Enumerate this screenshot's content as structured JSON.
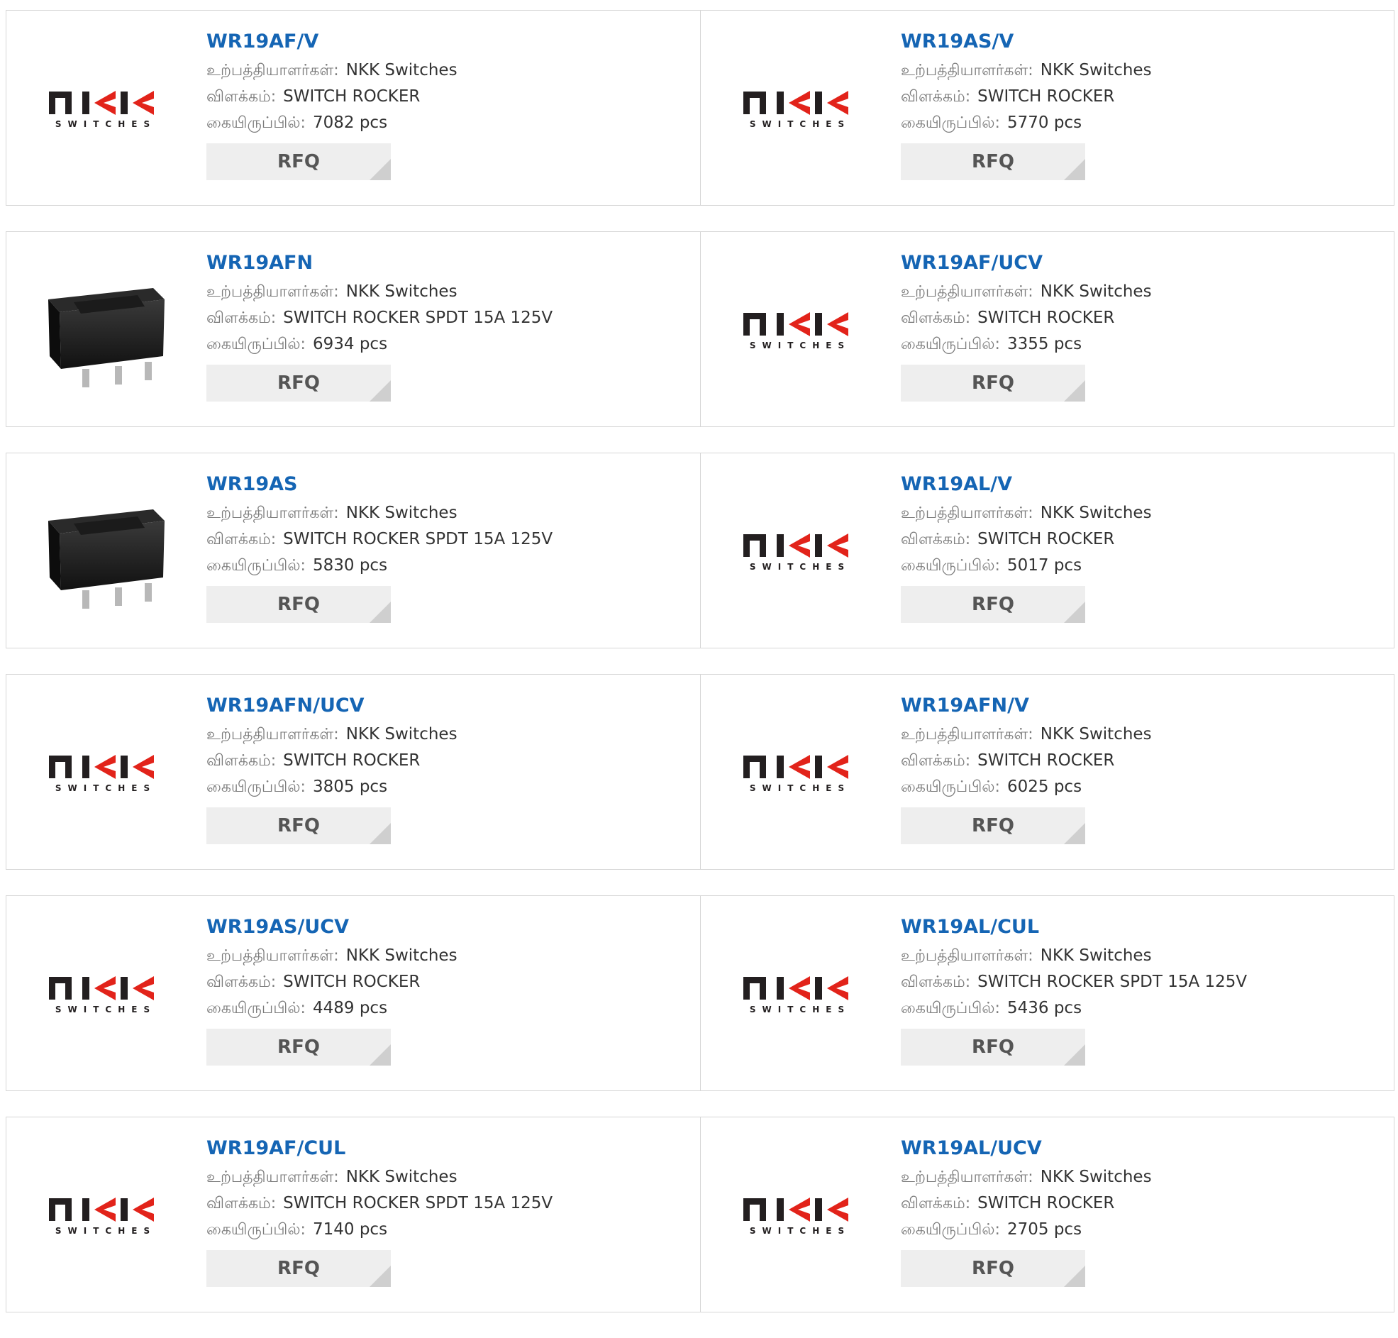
{
  "labels": {
    "manufacturer": "உற்பத்தியாளர்கள்:",
    "description": "விளக்கம்:",
    "stock": "கையிருப்பில்:",
    "rfq": "RFQ"
  },
  "colors": {
    "part_link": "#1565b4",
    "label": "#7c7c7c",
    "value": "#333333",
    "rfq_bg": "#eeeeee",
    "border": "#d6d6d6",
    "logo_red": "#e2231a",
    "logo_black": "#231f20"
  },
  "logo": {
    "wordmark": "NKK",
    "subtext": "SWITCHES"
  },
  "products": [
    {
      "part": "WR19AF/V",
      "manufacturer": "NKK Switches",
      "description": "SWITCH ROCKER",
      "stock": "7082 pcs",
      "image": "nkk-logo"
    },
    {
      "part": "WR19AS/V",
      "manufacturer": "NKK Switches",
      "description": "SWITCH ROCKER",
      "stock": "5770 pcs",
      "image": "nkk-logo"
    },
    {
      "part": "WR19AFN",
      "manufacturer": "NKK Switches",
      "description": "SWITCH ROCKER SPDT 15A 125V",
      "stock": "6934 pcs",
      "image": "rocker-switch-photo"
    },
    {
      "part": "WR19AF/UCV",
      "manufacturer": "NKK Switches",
      "description": "SWITCH ROCKER",
      "stock": "3355 pcs",
      "image": "nkk-logo"
    },
    {
      "part": "WR19AS",
      "manufacturer": "NKK Switches",
      "description": "SWITCH ROCKER SPDT 15A 125V",
      "stock": "5830 pcs",
      "image": "rocker-switch-photo"
    },
    {
      "part": "WR19AL/V",
      "manufacturer": "NKK Switches",
      "description": "SWITCH ROCKER",
      "stock": "5017 pcs",
      "image": "nkk-logo"
    },
    {
      "part": "WR19AFN/UCV",
      "manufacturer": "NKK Switches",
      "description": "SWITCH ROCKER",
      "stock": "3805 pcs",
      "image": "nkk-logo"
    },
    {
      "part": "WR19AFN/V",
      "manufacturer": "NKK Switches",
      "description": "SWITCH ROCKER",
      "stock": "6025 pcs",
      "image": "nkk-logo"
    },
    {
      "part": "WR19AS/UCV",
      "manufacturer": "NKK Switches",
      "description": "SWITCH ROCKER",
      "stock": "4489 pcs",
      "image": "nkk-logo"
    },
    {
      "part": "WR19AL/CUL",
      "manufacturer": "NKK Switches",
      "description": "SWITCH ROCKER SPDT 15A 125V",
      "stock": "5436 pcs",
      "image": "nkk-logo"
    },
    {
      "part": "WR19AF/CUL",
      "manufacturer": "NKK Switches",
      "description": "SWITCH ROCKER SPDT 15A 125V",
      "stock": "7140 pcs",
      "image": "nkk-logo"
    },
    {
      "part": "WR19AL/UCV",
      "manufacturer": "NKK Switches",
      "description": "SWITCH ROCKER",
      "stock": "2705 pcs",
      "image": "nkk-logo"
    }
  ]
}
